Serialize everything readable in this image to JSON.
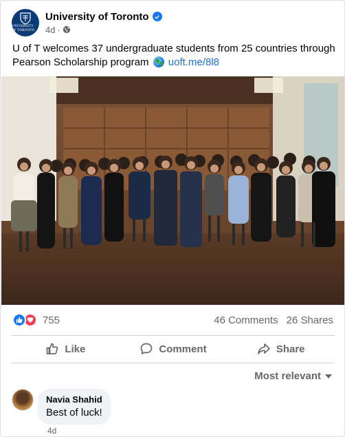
{
  "post": {
    "page_name": "University of Toronto",
    "time": "4d",
    "text_main": "U of T welcomes 37 undergraduate students from 25 countries through Pearson Scholarship program",
    "link": "uoft.me/8l8"
  },
  "logo": {
    "text": "UNIVERSITY OF TORONTO"
  },
  "reactions": {
    "count": "755",
    "comments": "46 Comments",
    "shares": "26 Shares"
  },
  "actions": {
    "like": "Like",
    "comment": "Comment",
    "share": "Share"
  },
  "sort": {
    "label": "Most relevant"
  },
  "comment": {
    "author": "Navia Shahid",
    "text": "Best of luck!",
    "time": "4d"
  },
  "colors": {
    "brand_blue": "#1877f2",
    "link_blue": "#216fdb",
    "love_red": "#f33e58",
    "muted_text": "#65676b"
  }
}
